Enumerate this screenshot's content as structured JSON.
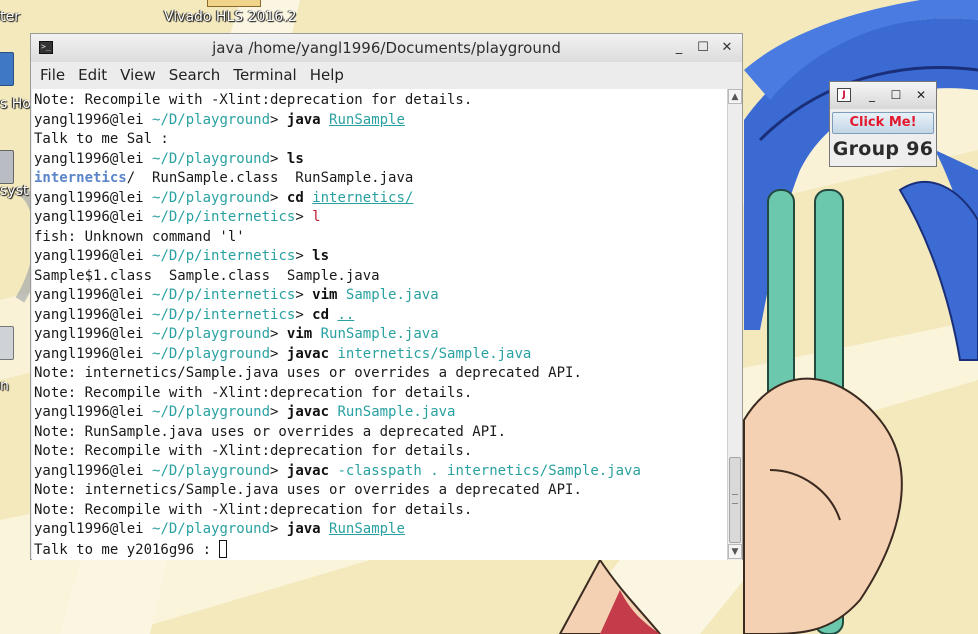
{
  "desktop": {
    "icons": [
      {
        "label": "ter"
      },
      {
        "label": "Vivado HLS 2016.2"
      },
      {
        "label": "s Ho"
      },
      {
        "label": "syst"
      },
      {
        "label": "n"
      }
    ]
  },
  "terminal": {
    "title": "java  /home/yangl1996/Documents/playground",
    "icon": "terminal-icon",
    "controls": {
      "minimize": "_",
      "maximize": "☐",
      "close": "✕"
    },
    "menu": [
      "File",
      "Edit",
      "View",
      "Search",
      "Terminal",
      "Help"
    ],
    "lines": [
      {
        "plain": "Note: Recompile with -Xlint:deprecation for details."
      },
      {
        "user": "yangl1996@lei",
        "path": "~/D/playground",
        "cmd": "java",
        "arg": "RunSample",
        "arg_style": "link"
      },
      {
        "plain": "Talk to me Sal :"
      },
      {
        "user": "yangl1996@lei",
        "path": "~/D/playground",
        "cmd": "ls"
      },
      {
        "dir": "internetics",
        "rest": "/  RunSample.class  RunSample.java"
      },
      {
        "user": "yangl1996@lei",
        "path": "~/D/playground",
        "cmd": "cd",
        "arg": "internetics/",
        "arg_style": "link"
      },
      {
        "user": "yangl1996@lei",
        "path": "~/D/p/internetics",
        "err": "l"
      },
      {
        "plain": "fish: Unknown command 'l'"
      },
      {
        "user": "yangl1996@lei",
        "path": "~/D/p/internetics",
        "cmd": "ls"
      },
      {
        "plain": "Sample$1.class  Sample.class  Sample.java"
      },
      {
        "user": "yangl1996@lei",
        "path": "~/D/p/internetics",
        "cmd": "vim",
        "arg": "Sample.java",
        "arg_style": "plain"
      },
      {
        "user": "yangl1996@lei",
        "path": "~/D/p/internetics",
        "cmd": "cd",
        "arg": "..",
        "arg_style": "link"
      },
      {
        "user": "yangl1996@lei",
        "path": "~/D/playground",
        "cmd": "vim",
        "arg": "RunSample.java",
        "arg_style": "plain"
      },
      {
        "user": "yangl1996@lei",
        "path": "~/D/playground",
        "cmd": "javac",
        "arg": "internetics/Sample.java",
        "arg_style": "plain"
      },
      {
        "plain": "Note: internetics/Sample.java uses or overrides a deprecated API."
      },
      {
        "plain": "Note: Recompile with -Xlint:deprecation for details."
      },
      {
        "user": "yangl1996@lei",
        "path": "~/D/playground",
        "cmd": "javac",
        "arg": "RunSample.java",
        "arg_style": "plain"
      },
      {
        "plain": "Note: RunSample.java uses or overrides a deprecated API."
      },
      {
        "plain": "Note: Recompile with -Xlint:deprecation for details."
      },
      {
        "user": "yangl1996@lei",
        "path": "~/D/playground",
        "cmd": "javac",
        "arg": "-classpath . internetics/Sample.java",
        "arg_style": "plain"
      },
      {
        "plain": "Note: internetics/Sample.java uses or overrides a deprecated API."
      },
      {
        "plain": "Note: Recompile with -Xlint:deprecation for details."
      },
      {
        "user": "yangl1996@lei",
        "path": "~/D/playground",
        "cmd": "java",
        "arg": "RunSample",
        "arg_style": "link"
      },
      {
        "plain": "Talk to me y2016g96 : ",
        "cursor": true
      }
    ],
    "scrollbar": {
      "up": "▲",
      "down": "▼"
    }
  },
  "swing_window": {
    "icon": "java-icon",
    "controls": {
      "minimize": "_",
      "maximize": "☐",
      "close": "✕"
    },
    "button_label": "Click Me!",
    "label": "Group 96"
  },
  "colors": {
    "path": "#2aa1a1",
    "error": "#c0192f",
    "directory": "#5a85c8",
    "button_text": "#e3182d"
  }
}
